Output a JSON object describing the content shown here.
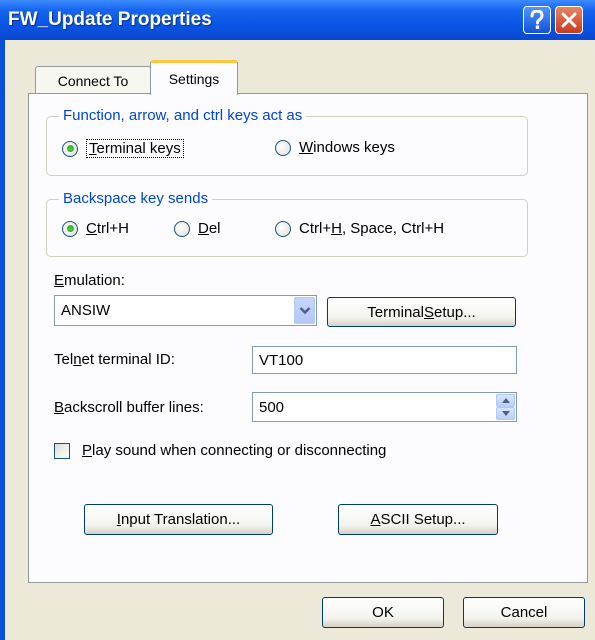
{
  "window": {
    "title": "FW_Update Properties"
  },
  "tabs": [
    {
      "label": "Connect To",
      "selected": false
    },
    {
      "label": "Settings",
      "selected": true
    }
  ],
  "function_keys_group": {
    "legend": "Function, arrow, and ctrl keys act as",
    "options": [
      {
        "label_before": "",
        "accel": "T",
        "label_after": "erminal keys",
        "selected": true
      },
      {
        "label_before": "",
        "accel": "W",
        "label_after": "indows keys",
        "selected": false
      }
    ]
  },
  "backspace_group": {
    "legend": "Backspace key sends",
    "options": [
      {
        "label_before": "",
        "accel": "C",
        "label_after": "trl+H",
        "selected": true
      },
      {
        "label_before": "",
        "accel": "D",
        "label_after": "el",
        "selected": false
      },
      {
        "label_before": "Ctrl+",
        "accel": "H",
        "label_after": ", Space, Ctrl+H",
        "selected": false
      }
    ]
  },
  "emulation": {
    "label_accel": "E",
    "label_rest": "mulation:",
    "value": "ANSIW",
    "setup_button": {
      "before": "Terminal ",
      "accel": "S",
      "after": "etup..."
    }
  },
  "telnet_id": {
    "label_before": "Tel",
    "label_accel": "n",
    "label_after": "et terminal ID:",
    "value": "VT100"
  },
  "backscroll": {
    "label_accel": "B",
    "label_rest": "ackscroll buffer lines:",
    "value": "500"
  },
  "play_sound": {
    "accel": "P",
    "rest": "lay sound when connecting or disconnecting",
    "checked": false
  },
  "input_translation_button": {
    "accel": "I",
    "rest": "nput Translation..."
  },
  "ascii_setup_button": {
    "accel": "A",
    "rest": "SCII Setup..."
  },
  "dialog_buttons": {
    "ok": "OK",
    "cancel": "Cancel"
  },
  "colors": {
    "titlebar": "#0a55e6",
    "legend_text": "#0046d5",
    "radio_dot": "#21a121",
    "close_button": "#c83a1c"
  }
}
